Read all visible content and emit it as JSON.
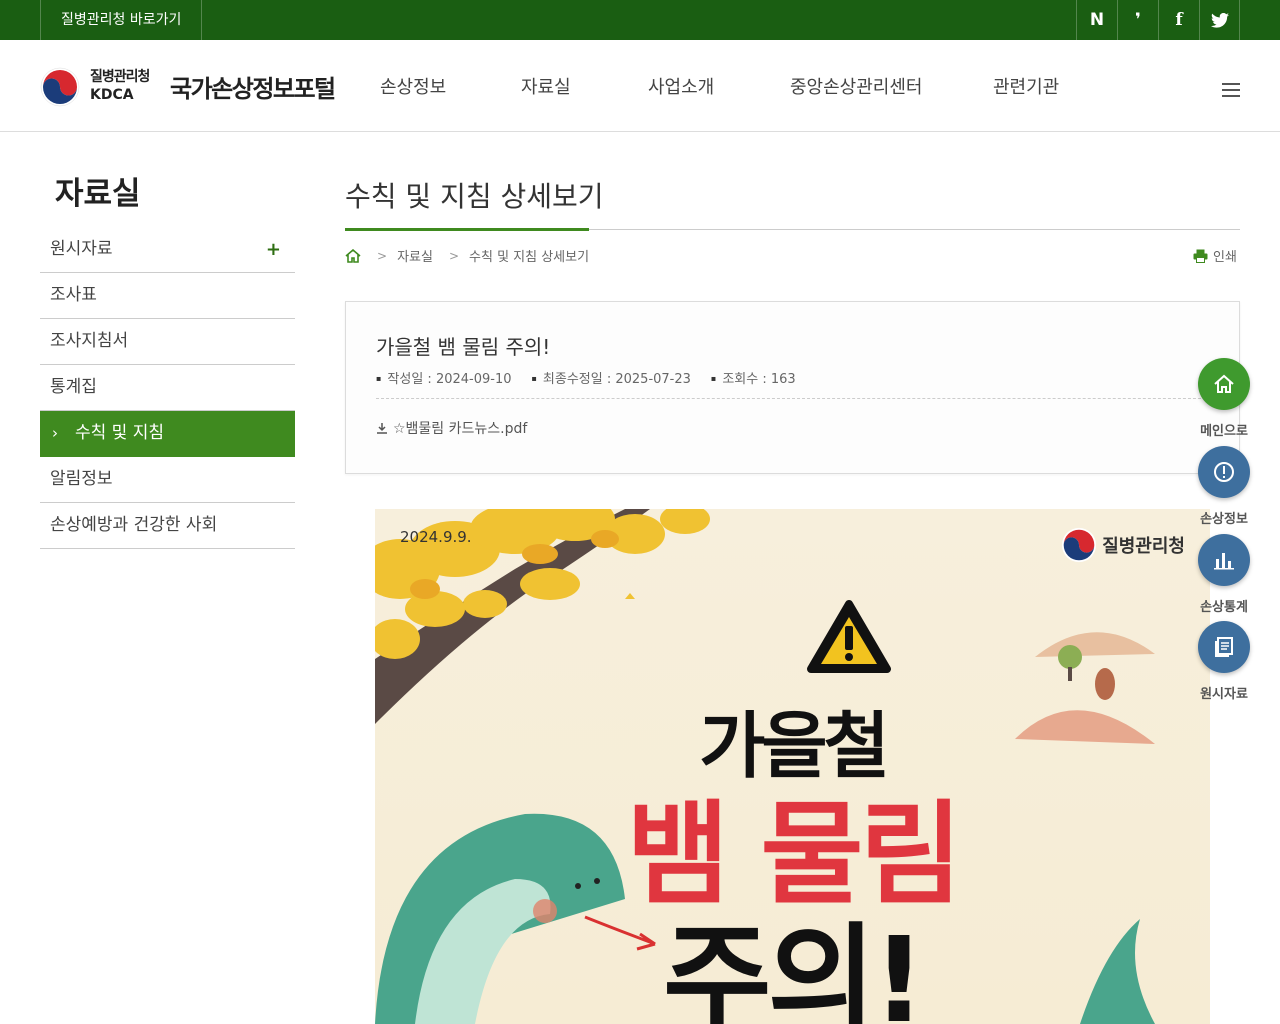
{
  "topbar": {
    "kdca_link": "질병관리청 바로가기",
    "sns": [
      "naver-blog-icon",
      "brunch-icon",
      "facebook-icon",
      "twitter-icon"
    ]
  },
  "header": {
    "logo_ko": "질병관리청",
    "logo_en": "KDCA",
    "portal_name": "국가손상정보포털",
    "gnb": [
      "손상정보",
      "자료실",
      "사업소개",
      "중앙손상관리센터",
      "관련기관"
    ]
  },
  "sidebar": {
    "title": "자료실",
    "items": [
      {
        "label": "원시자료",
        "has_sub": true
      },
      {
        "label": "조사표"
      },
      {
        "label": "조사지침서"
      },
      {
        "label": "통계집"
      },
      {
        "label": "수칙 및 지침",
        "active": true
      },
      {
        "label": "알림정보"
      },
      {
        "label": "손상예방과 건강한 사회"
      }
    ]
  },
  "content": {
    "page_title": "수칙 및 지침 상세보기",
    "breadcrumb": [
      "자료실",
      "수칙 및 지침 상세보기"
    ],
    "print_label": "인쇄"
  },
  "post": {
    "title": "가을철 뱀 물림 주의!",
    "meta": {
      "created": "작성일 : 2024-09-10",
      "modified": "최종수정일 : 2025-07-23",
      "views": "조회수 : 163"
    },
    "attachment": "☆뱀물림 카드뉴스.pdf"
  },
  "poster": {
    "date": "2024.9.9.",
    "org": "질병관리청",
    "line1": "가을철",
    "line2": "뱀 물림",
    "line3": "주의!"
  },
  "quick_menu": [
    {
      "label": "메인으로",
      "icon": "home-icon",
      "color": "#3f9a2e"
    },
    {
      "label": "손상정보",
      "icon": "alert-icon",
      "color": "#3e6f9e"
    },
    {
      "label": "손상통계",
      "icon": "bar-chart-icon",
      "color": "#3e6f9e"
    },
    {
      "label": "원시자료",
      "icon": "document-icon",
      "color": "#3e6f9e"
    }
  ],
  "colors": {
    "topbar": "#1a5e12",
    "accent_green": "#3f8a1f",
    "poster_red": "#e0363f"
  }
}
